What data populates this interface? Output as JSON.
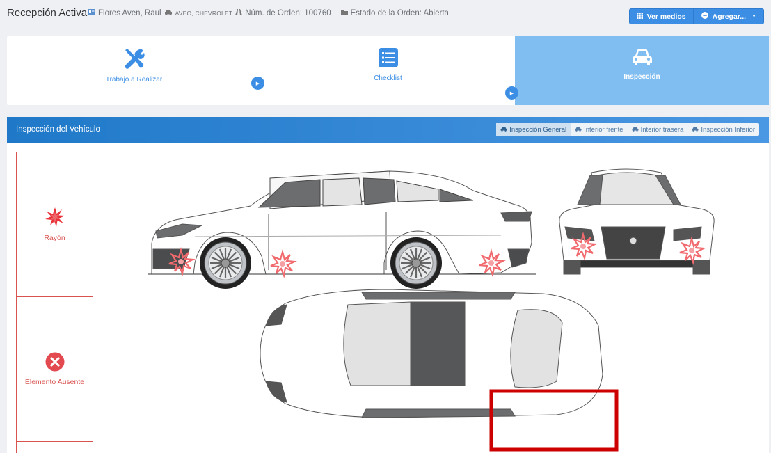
{
  "header": {
    "title": "Recepción Activa",
    "client": "Flores Aven, Raul",
    "vehicle": "AVEO, CHEVROLET",
    "order_number": "Núm. de Orden: 100760",
    "order_status": "Estado de la Orden: Abierta",
    "buttons": {
      "ver_medios": "Ver medios",
      "agregar": "Agregar..."
    }
  },
  "steps": [
    {
      "label": "Trabajo a Realizar",
      "icon": "tools-icon"
    },
    {
      "label": "Checklist",
      "icon": "checklist-icon"
    },
    {
      "label": "Inspección",
      "icon": "car-icon",
      "active": true
    }
  ],
  "panel": {
    "title": "Inspección del Vehículo",
    "tabs": [
      {
        "label": "Inspección General",
        "active": true
      },
      {
        "label": "Interior frente"
      },
      {
        "label": "Interior trasera"
      },
      {
        "label": "Inspección Inferior"
      }
    ]
  },
  "legend": [
    {
      "label": "Rayón",
      "icon": "scratch-icon"
    },
    {
      "label": "Elemento Ausente",
      "icon": "missing-icon"
    }
  ],
  "colors": {
    "primary": "#3b8ee4",
    "active_step": "#80bdf0",
    "danger": "#d9534f",
    "highlight": "#cc0000"
  }
}
